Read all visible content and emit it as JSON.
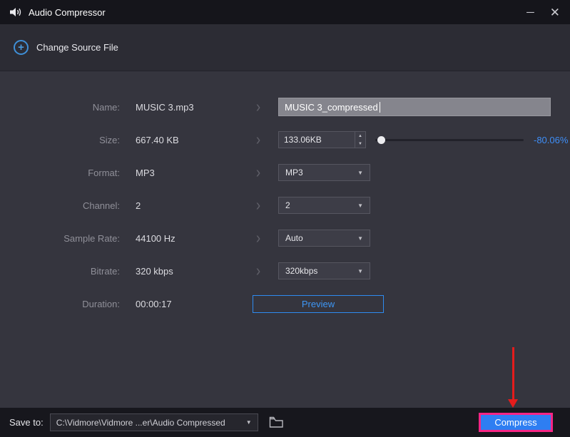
{
  "window": {
    "title": "Audio Compressor",
    "minimize_icon": "─",
    "close_icon": "✕"
  },
  "header": {
    "plus_icon": "+",
    "change_source_label": "Change Source File"
  },
  "icons": {
    "chevron": "›",
    "dropdown_arrow": "▼",
    "spin_up": "▲",
    "spin_down": "▼"
  },
  "form": {
    "name": {
      "label": "Name:",
      "value": "MUSIC 3.mp3",
      "input": "MUSIC 3_compressed"
    },
    "size": {
      "label": "Size:",
      "value": "667.40 KB",
      "input": "133.06KB",
      "reduction": "-80.06%"
    },
    "format": {
      "label": "Format:",
      "value": "MP3",
      "selected": "MP3"
    },
    "channel": {
      "label": "Channel:",
      "value": "2",
      "selected": "2"
    },
    "sample_rate": {
      "label": "Sample Rate:",
      "value": "44100 Hz",
      "selected": "Auto"
    },
    "bitrate": {
      "label": "Bitrate:",
      "value": "320 kbps",
      "selected": "320kbps"
    },
    "duration": {
      "label": "Duration:",
      "value": "00:00:17",
      "preview_label": "Preview"
    }
  },
  "footer": {
    "save_to_label": "Save to:",
    "path": "C:\\Vidmore\\Vidmore ...er\\Audio Compressed",
    "compress_label": "Compress"
  },
  "colors": {
    "accent_blue": "#2e7ef2",
    "reduction_blue": "#3e8ef7",
    "highlight_pink": "#f72585",
    "annotation_red": "#e51c1c"
  }
}
